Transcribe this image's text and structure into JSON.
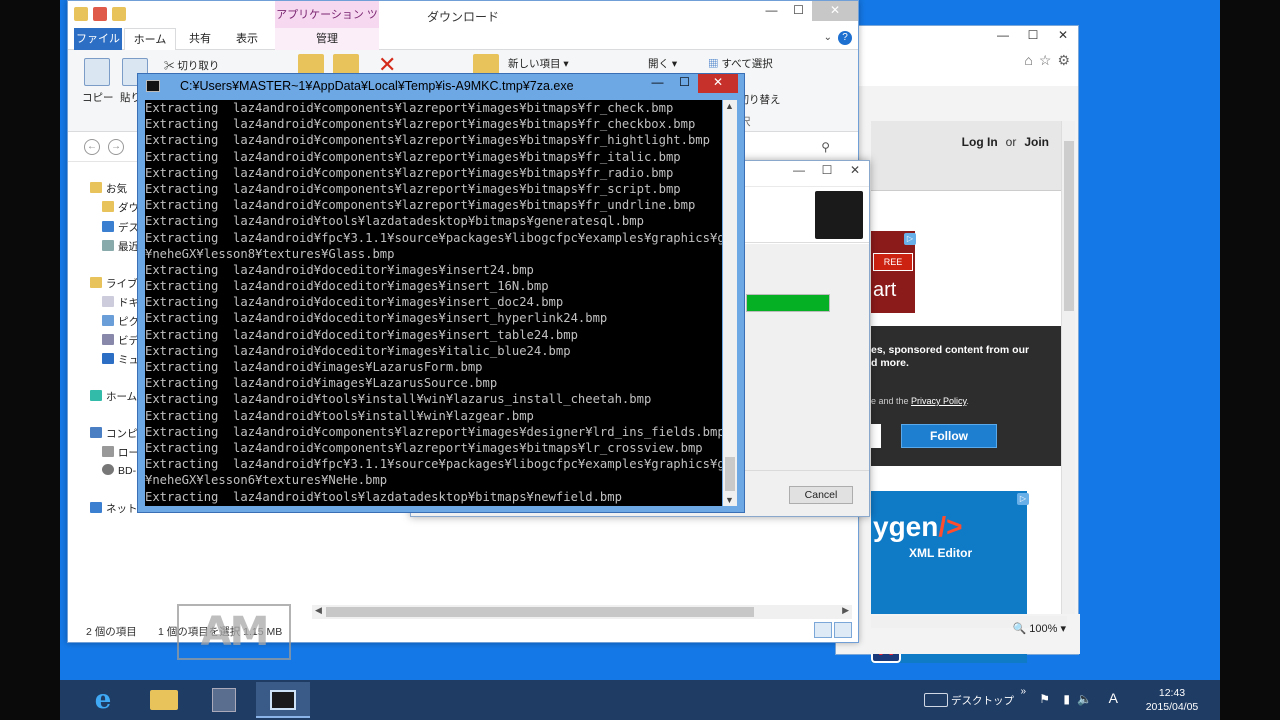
{
  "explorer": {
    "title": "ダウンロード",
    "app_tools_label": "アプリケーション ツール",
    "tabs": [
      "ファイル",
      "ホーム",
      "共有",
      "表示",
      "管理"
    ],
    "ribbon": {
      "cut": "切り取り",
      "copy": "コピー",
      "paste": "貼り",
      "new_item": "新しい項目 ▾",
      "open": "開く ▾",
      "select_all": "すべて選択",
      "deselect": "除",
      "invert": "の切り替え",
      "select_group": "沢"
    },
    "nav_items": [
      "お気",
      "ダウ",
      "デス",
      "最近",
      "ライブ",
      "ドキ",
      "ピク",
      "ビデ",
      "ミュ",
      "ホーム",
      "コンピ",
      "ロー",
      "BD-",
      "ネット"
    ],
    "status": {
      "count": "2 個の項目",
      "selected": "1 個の項目を選択 1.15 MB"
    }
  },
  "console": {
    "title": "C:¥Users¥MASTER~1¥AppData¥Local¥Temp¥is-A9MKC.tmp¥7za.exe",
    "lines": [
      "Extracting  laz4android¥components¥lazreport¥images¥bitmaps¥fr_check.bmp",
      "Extracting  laz4android¥components¥lazreport¥images¥bitmaps¥fr_checkbox.bmp",
      "Extracting  laz4android¥components¥lazreport¥images¥bitmaps¥fr_hightlight.bmp",
      "Extracting  laz4android¥components¥lazreport¥images¥bitmaps¥fr_italic.bmp",
      "Extracting  laz4android¥components¥lazreport¥images¥bitmaps¥fr_radio.bmp",
      "Extracting  laz4android¥components¥lazreport¥images¥bitmaps¥fr_script.bmp",
      "Extracting  laz4android¥components¥lazreport¥images¥bitmaps¥fr_undrline.bmp",
      "Extracting  laz4android¥tools¥lazdatadesktop¥bitmaps¥generatesql.bmp",
      "Extracting  laz4android¥fpc¥3.1.1¥source¥packages¥libogcfpc¥examples¥graphics¥gx",
      "¥neheGX¥lesson8¥textures¥Glass.bmp",
      "Extracting  laz4android¥doceditor¥images¥insert24.bmp",
      "Extracting  laz4android¥doceditor¥images¥insert_16N.bmp",
      "Extracting  laz4android¥doceditor¥images¥insert_doc24.bmp",
      "Extracting  laz4android¥doceditor¥images¥insert_hyperlink24.bmp",
      "Extracting  laz4android¥doceditor¥images¥insert_table24.bmp",
      "Extracting  laz4android¥doceditor¥images¥italic_blue24.bmp",
      "Extracting  laz4android¥images¥LazarusForm.bmp",
      "Extracting  laz4android¥images¥LazarusSource.bmp",
      "Extracting  laz4android¥tools¥install¥win¥lazarus_install_cheetah.bmp",
      "Extracting  laz4android¥tools¥install¥win¥lazgear.bmp",
      "Extracting  laz4android¥components¥lazreport¥images¥designer¥lrd_ins_fields.bmp",
      "Extracting  laz4android¥components¥lazreport¥images¥bitmaps¥lr_crossview.bmp",
      "Extracting  laz4android¥fpc¥3.1.1¥source¥packages¥libogcfpc¥examples¥graphics¥gx",
      "¥neheGX¥lesson6¥textures¥NeHe.bmp",
      "Extracting  laz4android¥tools¥lazdatadesktop¥bitmaps¥newfield.bmp"
    ]
  },
  "setup": {
    "cancel": "Cancel",
    "progress_percent": 100
  },
  "browser": {
    "login": "Log In",
    "or": "or",
    "join": "Join",
    "ad_tag": "REE",
    "ad_word": "art",
    "sponsored_text": "es, sponsored content from our\nd more.",
    "privacy_prefix": "e and the ",
    "privacy_link": "Privacy Policy",
    "privacy_suffix": ".",
    "follow": "Follow",
    "ad2_brand": "ygen",
    "ad2_slash": "/>",
    "ad2_sub": "XML Editor",
    "zoom": "100%"
  },
  "watermark": "AM",
  "taskbar": {
    "desktop_label": "デスクトップ",
    "time": "12:43",
    "date": "2015/04/05",
    "ime": "A"
  },
  "colors": {
    "desktop": "#1478e6",
    "progress": "#06b025",
    "console_bg": "#000000",
    "taskbar": "#1f3c64"
  }
}
